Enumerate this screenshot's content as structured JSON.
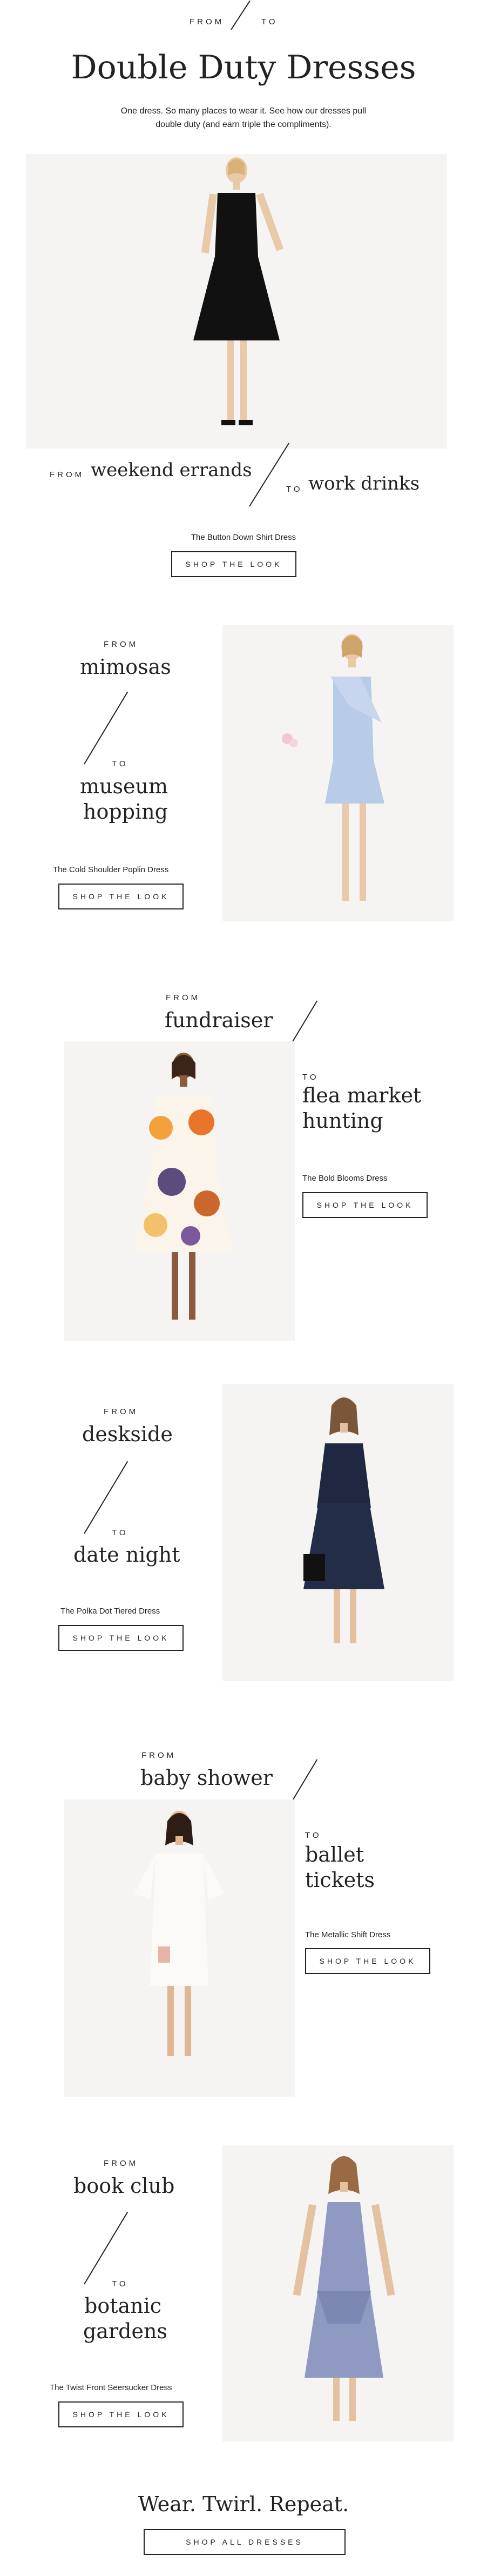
{
  "header": {
    "from": "FROM",
    "to": "TO",
    "title": "Double Duty Dresses",
    "subtitle_line1": "One dress. So many places to wear it.  See how our dresses pull",
    "subtitle_line2": "double duty (and earn triple the compliments)."
  },
  "looks": [
    {
      "from_label": "FROM",
      "from_text": "weekend errands",
      "to_label": "TO",
      "to_text": "work drinks",
      "product": "The Button Down Shirt Dress",
      "cta": "SHOP THE LOOK",
      "image": "black-shirt-dress-photo"
    },
    {
      "from_label": "FROM",
      "from_text": "mimosas",
      "to_label": "TO",
      "to_text_1": "museum",
      "to_text_2": "hopping",
      "product": "The Cold Shoulder Poplin Dress",
      "cta": "SHOP THE LOOK",
      "image": "blue-poplin-dress-photo"
    },
    {
      "from_label": "FROM",
      "from_text": "fundraiser",
      "to_label": "TO",
      "to_text_1": "flea market",
      "to_text_2": "hunting",
      "product": "The Bold Blooms Dress",
      "cta": "SHOP THE LOOK",
      "image": "floral-dress-photo"
    },
    {
      "from_label": "FROM",
      "from_text": "deskside",
      "to_label": "TO",
      "to_text": "date night",
      "product": "The Polka Dot Tiered Dress",
      "cta": "SHOP THE LOOK",
      "image": "polka-dot-dress-photo"
    },
    {
      "from_label": "FROM",
      "from_text": "baby shower",
      "to_label": "TO",
      "to_text_1": "ballet",
      "to_text_2": "tickets",
      "product": "The Metallic Shift Dress",
      "cta": "SHOP THE LOOK",
      "image": "white-shift-dress-photo"
    },
    {
      "from_label": "FROM",
      "from_text": "book club",
      "to_label": "TO",
      "to_text_1": "botanic",
      "to_text_2": "gardens",
      "product": "The Twist Front Seersucker Dress",
      "cta": "SHOP THE LOOK",
      "image": "seersucker-dress-photo"
    }
  ],
  "footer": {
    "tagline": "Wear. Twirl. Repeat.",
    "cta": "SHOP ALL DRESSES"
  }
}
